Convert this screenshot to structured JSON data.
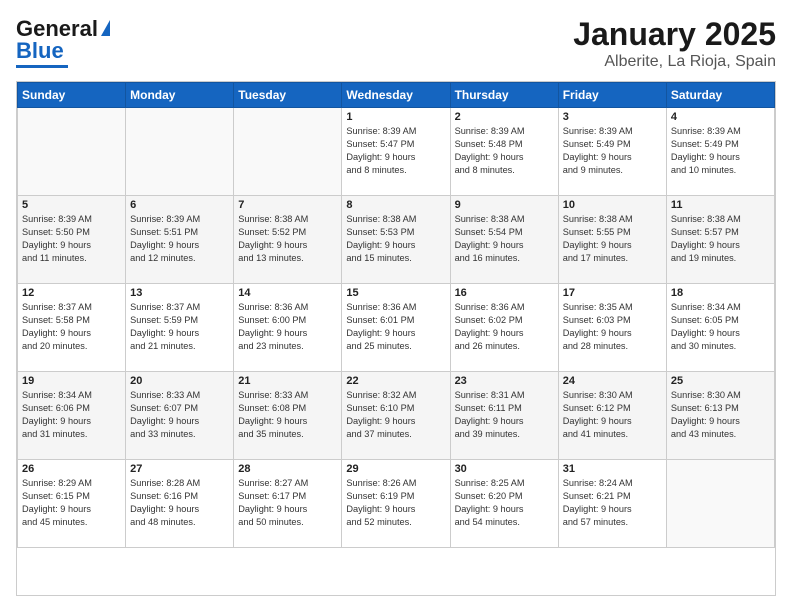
{
  "logo": {
    "line1": "General",
    "line2": "Blue"
  },
  "header": {
    "month": "January 2025",
    "location": "Alberite, La Rioja, Spain"
  },
  "weekdays": [
    "Sunday",
    "Monday",
    "Tuesday",
    "Wednesday",
    "Thursday",
    "Friday",
    "Saturday"
  ],
  "weeks": [
    [
      {
        "day": "",
        "info": ""
      },
      {
        "day": "",
        "info": ""
      },
      {
        "day": "",
        "info": ""
      },
      {
        "day": "1",
        "info": "Sunrise: 8:39 AM\nSunset: 5:47 PM\nDaylight: 9 hours\nand 8 minutes."
      },
      {
        "day": "2",
        "info": "Sunrise: 8:39 AM\nSunset: 5:48 PM\nDaylight: 9 hours\nand 8 minutes."
      },
      {
        "day": "3",
        "info": "Sunrise: 8:39 AM\nSunset: 5:49 PM\nDaylight: 9 hours\nand 9 minutes."
      },
      {
        "day": "4",
        "info": "Sunrise: 8:39 AM\nSunset: 5:49 PM\nDaylight: 9 hours\nand 10 minutes."
      }
    ],
    [
      {
        "day": "5",
        "info": "Sunrise: 8:39 AM\nSunset: 5:50 PM\nDaylight: 9 hours\nand 11 minutes."
      },
      {
        "day": "6",
        "info": "Sunrise: 8:39 AM\nSunset: 5:51 PM\nDaylight: 9 hours\nand 12 minutes."
      },
      {
        "day": "7",
        "info": "Sunrise: 8:38 AM\nSunset: 5:52 PM\nDaylight: 9 hours\nand 13 minutes."
      },
      {
        "day": "8",
        "info": "Sunrise: 8:38 AM\nSunset: 5:53 PM\nDaylight: 9 hours\nand 15 minutes."
      },
      {
        "day": "9",
        "info": "Sunrise: 8:38 AM\nSunset: 5:54 PM\nDaylight: 9 hours\nand 16 minutes."
      },
      {
        "day": "10",
        "info": "Sunrise: 8:38 AM\nSunset: 5:55 PM\nDaylight: 9 hours\nand 17 minutes."
      },
      {
        "day": "11",
        "info": "Sunrise: 8:38 AM\nSunset: 5:57 PM\nDaylight: 9 hours\nand 19 minutes."
      }
    ],
    [
      {
        "day": "12",
        "info": "Sunrise: 8:37 AM\nSunset: 5:58 PM\nDaylight: 9 hours\nand 20 minutes."
      },
      {
        "day": "13",
        "info": "Sunrise: 8:37 AM\nSunset: 5:59 PM\nDaylight: 9 hours\nand 21 minutes."
      },
      {
        "day": "14",
        "info": "Sunrise: 8:36 AM\nSunset: 6:00 PM\nDaylight: 9 hours\nand 23 minutes."
      },
      {
        "day": "15",
        "info": "Sunrise: 8:36 AM\nSunset: 6:01 PM\nDaylight: 9 hours\nand 25 minutes."
      },
      {
        "day": "16",
        "info": "Sunrise: 8:36 AM\nSunset: 6:02 PM\nDaylight: 9 hours\nand 26 minutes."
      },
      {
        "day": "17",
        "info": "Sunrise: 8:35 AM\nSunset: 6:03 PM\nDaylight: 9 hours\nand 28 minutes."
      },
      {
        "day": "18",
        "info": "Sunrise: 8:34 AM\nSunset: 6:05 PM\nDaylight: 9 hours\nand 30 minutes."
      }
    ],
    [
      {
        "day": "19",
        "info": "Sunrise: 8:34 AM\nSunset: 6:06 PM\nDaylight: 9 hours\nand 31 minutes."
      },
      {
        "day": "20",
        "info": "Sunrise: 8:33 AM\nSunset: 6:07 PM\nDaylight: 9 hours\nand 33 minutes."
      },
      {
        "day": "21",
        "info": "Sunrise: 8:33 AM\nSunset: 6:08 PM\nDaylight: 9 hours\nand 35 minutes."
      },
      {
        "day": "22",
        "info": "Sunrise: 8:32 AM\nSunset: 6:10 PM\nDaylight: 9 hours\nand 37 minutes."
      },
      {
        "day": "23",
        "info": "Sunrise: 8:31 AM\nSunset: 6:11 PM\nDaylight: 9 hours\nand 39 minutes."
      },
      {
        "day": "24",
        "info": "Sunrise: 8:30 AM\nSunset: 6:12 PM\nDaylight: 9 hours\nand 41 minutes."
      },
      {
        "day": "25",
        "info": "Sunrise: 8:30 AM\nSunset: 6:13 PM\nDaylight: 9 hours\nand 43 minutes."
      }
    ],
    [
      {
        "day": "26",
        "info": "Sunrise: 8:29 AM\nSunset: 6:15 PM\nDaylight: 9 hours\nand 45 minutes."
      },
      {
        "day": "27",
        "info": "Sunrise: 8:28 AM\nSunset: 6:16 PM\nDaylight: 9 hours\nand 48 minutes."
      },
      {
        "day": "28",
        "info": "Sunrise: 8:27 AM\nSunset: 6:17 PM\nDaylight: 9 hours\nand 50 minutes."
      },
      {
        "day": "29",
        "info": "Sunrise: 8:26 AM\nSunset: 6:19 PM\nDaylight: 9 hours\nand 52 minutes."
      },
      {
        "day": "30",
        "info": "Sunrise: 8:25 AM\nSunset: 6:20 PM\nDaylight: 9 hours\nand 54 minutes."
      },
      {
        "day": "31",
        "info": "Sunrise: 8:24 AM\nSunset: 6:21 PM\nDaylight: 9 hours\nand 57 minutes."
      },
      {
        "day": "",
        "info": ""
      }
    ]
  ]
}
